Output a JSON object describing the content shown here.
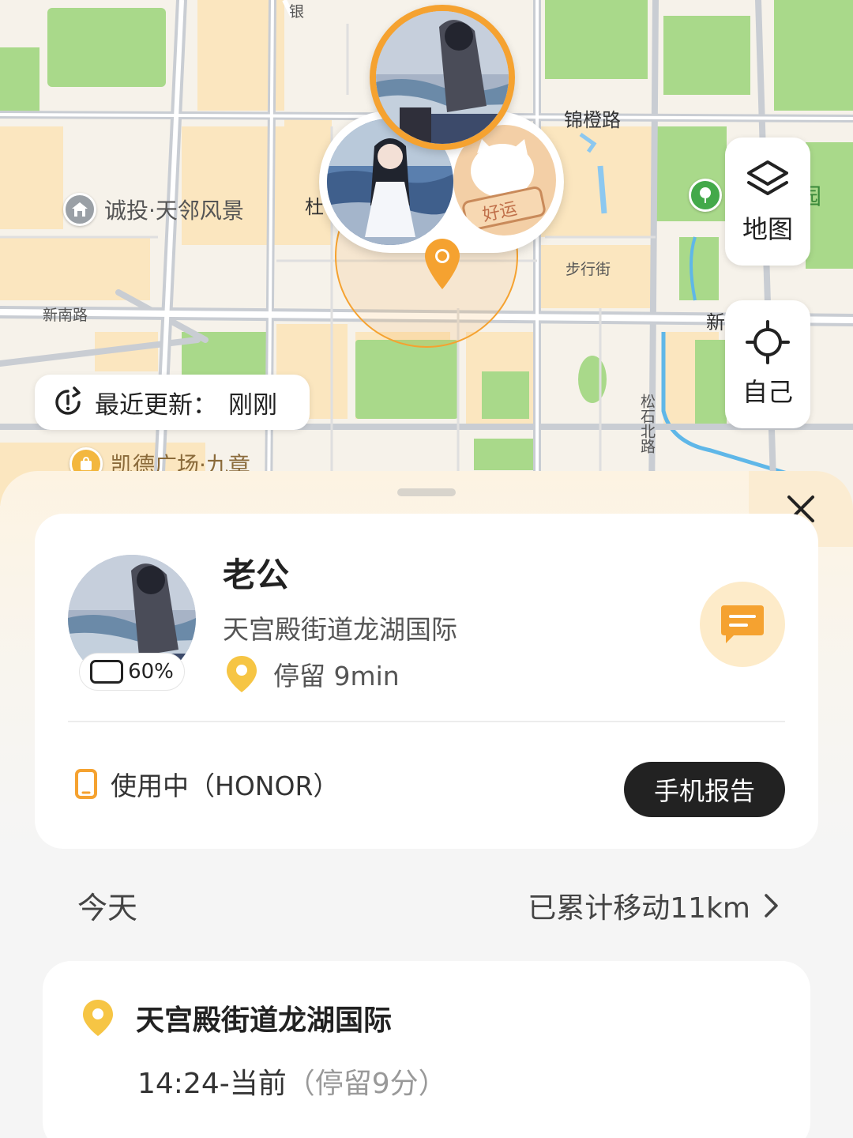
{
  "map": {
    "road_labels": [
      "锦橙路",
      "步行街",
      "新南路",
      "杜",
      "新",
      "松石北路",
      "银"
    ],
    "poi_1": "诚投·天邻风景",
    "poi_2": "凯德广场·九章",
    "poi_park": "公园",
    "layer_button_label": "地图",
    "self_button_label": "自己",
    "update_label": "最近更新：",
    "update_value": "刚刚",
    "sticker_text": "好运"
  },
  "sheet": {
    "contact": {
      "name": "老公",
      "address": "天宫殿街道龙湖国际",
      "stay": "停留 9min",
      "battery": "60%",
      "battery_level": 0.6
    },
    "device": {
      "status": "使用中（HONOR）",
      "report_button": "手机报告"
    },
    "today": {
      "label": "今天",
      "summary": "已累计移动11km"
    },
    "timeline": [
      {
        "place": "天宫殿街道龙湖国际",
        "time": "14:24-当前",
        "stay": "（停留9分）"
      }
    ]
  },
  "colors": {
    "accent_orange": "#f5a230",
    "pin_yellow": "#f6c544",
    "battery_green": "#8ed05f",
    "dark_button": "#222222",
    "map_green": "#a9d98a",
    "map_block": "#fbe6bf"
  },
  "icons": [
    "layers-icon",
    "locate-icon",
    "clock-refresh-icon",
    "close-icon",
    "message-icon",
    "location-pin-icon",
    "phone-icon",
    "chevron-right-icon",
    "home-poi-icon",
    "tree-poi-icon",
    "shopping-poi-icon"
  ]
}
